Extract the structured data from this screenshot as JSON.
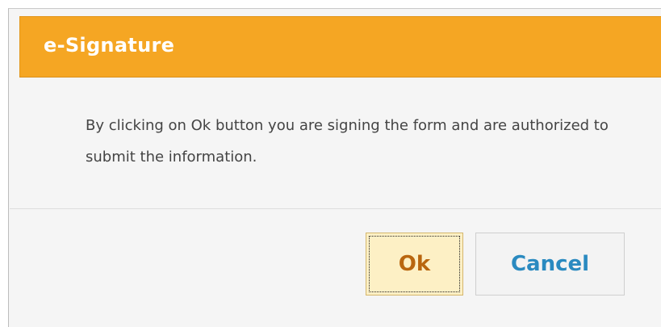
{
  "dialog": {
    "title": "e-Signature",
    "message": "By clicking on Ok button you are signing the form and are authorized to submit the information.",
    "ok_label": "Ok",
    "cancel_label": "Cancel"
  },
  "colors": {
    "header_bg": "#f5a623",
    "header_text": "#ffffff",
    "body_bg": "#f5f5f5",
    "ok_bg": "#fdf0c5",
    "ok_text": "#b9660f",
    "cancel_text": "#2a8ac0"
  }
}
